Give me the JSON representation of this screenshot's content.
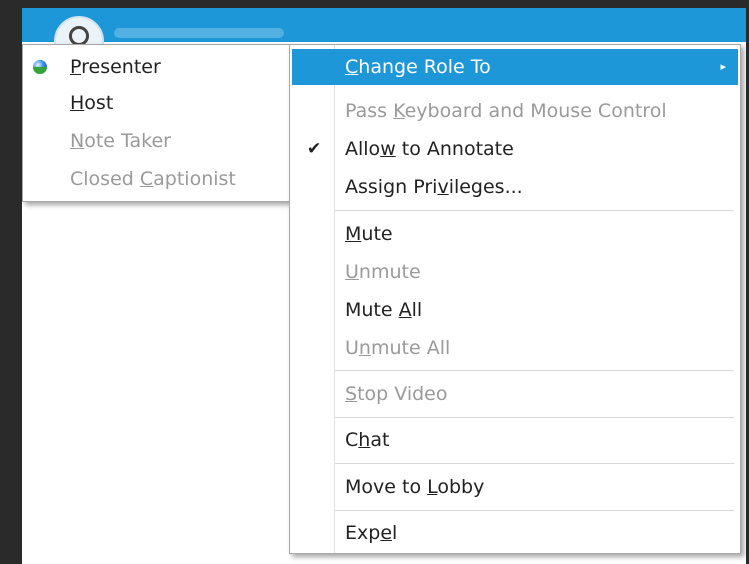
{
  "submenu": {
    "items": [
      {
        "pre": "",
        "u": "P",
        "post": "resenter",
        "enabled": true
      },
      {
        "pre": "",
        "u": "H",
        "post": "ost",
        "enabled": true
      },
      {
        "pre": "",
        "u": "N",
        "post": "ote Taker",
        "enabled": false
      },
      {
        "pre": "Closed ",
        "u": "C",
        "post": "aptionist",
        "enabled": false
      }
    ]
  },
  "context_menu": {
    "change_role": {
      "pre": "",
      "u": "C",
      "post": "hange Role To"
    },
    "pass_control": {
      "pre": "Pass ",
      "u": "K",
      "post": "eyboard and Mouse Control"
    },
    "allow_annotate": {
      "pre": "Allo",
      "u": "w",
      "post": " to Annotate",
      "check": "✔"
    },
    "assign_privileges": {
      "pre": "Assign Pri",
      "u": "v",
      "post": "ileges..."
    },
    "mute": {
      "pre": "",
      "u": "M",
      "post": "ute"
    },
    "unmute": {
      "pre": "",
      "u": "U",
      "post": "nmute"
    },
    "mute_all": {
      "pre": "Mute ",
      "u": "A",
      "post": "ll"
    },
    "unmute_all": {
      "pre": "U",
      "u": "n",
      "post": "mute All"
    },
    "stop_video": {
      "pre": "",
      "u": "S",
      "post": "top Video"
    },
    "chat": {
      "pre": "C",
      "u": "h",
      "post": "at"
    },
    "move_to_lobby": {
      "pre": "Move to ",
      "u": "L",
      "post": "obby"
    },
    "expel": {
      "pre": "Exp",
      "u": "e",
      "post": "l"
    }
  }
}
